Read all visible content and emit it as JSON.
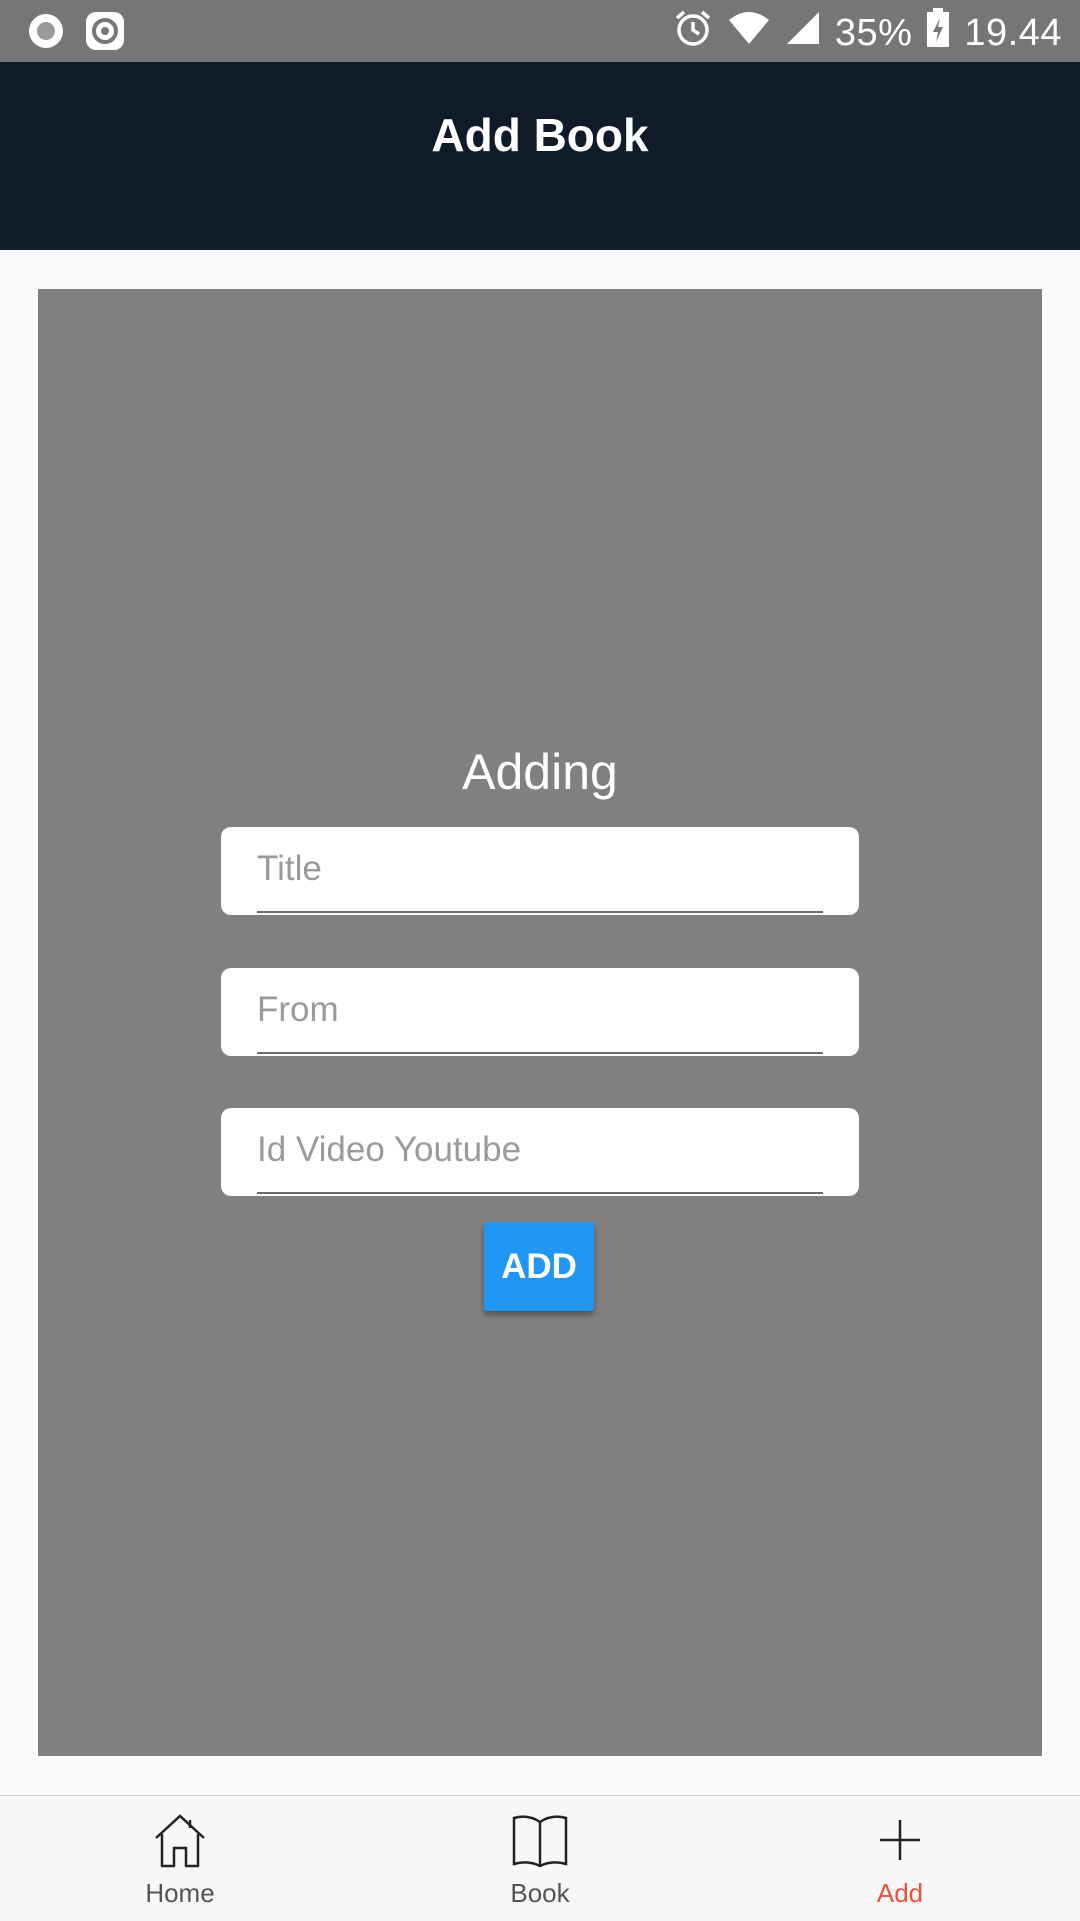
{
  "status_bar": {
    "battery_percent": "35%",
    "time": "19.44",
    "icons": [
      "record-icon",
      "screen-recorder-icon",
      "alarm-icon",
      "wifi-icon",
      "signal-icon",
      "battery-charging-icon"
    ]
  },
  "app_bar": {
    "title": "Add Book",
    "background_color": "#0f1b29"
  },
  "form": {
    "heading": "Adding",
    "fields": [
      {
        "placeholder": "Title",
        "value": ""
      },
      {
        "placeholder": "From",
        "value": ""
      },
      {
        "placeholder": "Id Video Youtube",
        "value": ""
      }
    ],
    "submit_label": "ADD",
    "submit_color": "#2196f3"
  },
  "bottom_nav": {
    "items": [
      {
        "label": "Home",
        "icon": "home-icon",
        "active": false
      },
      {
        "label": "Book",
        "icon": "book-icon",
        "active": false
      },
      {
        "label": "Add",
        "icon": "plus-icon",
        "active": true
      }
    ],
    "active_color": "#e8533a"
  }
}
